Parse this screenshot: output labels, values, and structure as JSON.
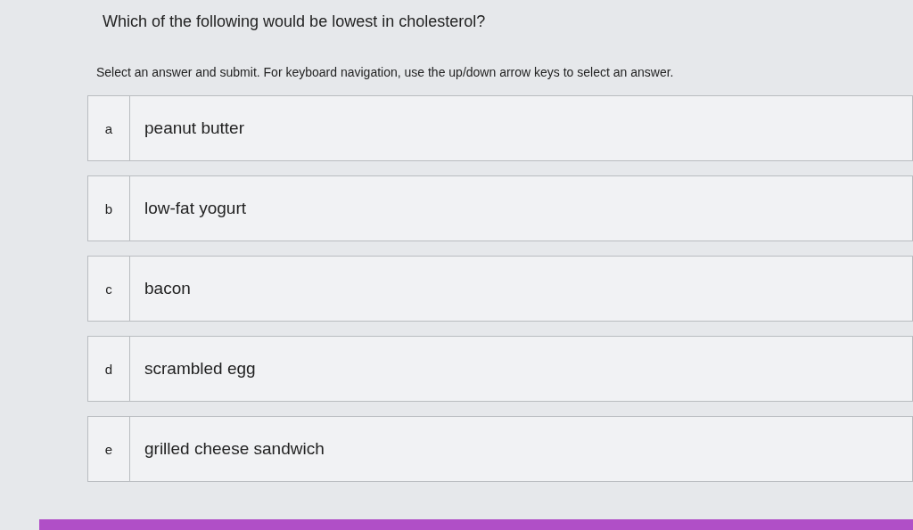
{
  "question": "Which of the following would be lowest in cholesterol?",
  "instructions": "Select an answer and submit. For keyboard navigation, use the up/down arrow keys to select an answer.",
  "answers": [
    {
      "letter": "a",
      "text": "peanut butter",
      "selected": false
    },
    {
      "letter": "b",
      "text": "low-fat yogurt",
      "selected": false
    },
    {
      "letter": "c",
      "text": "bacon",
      "selected": false
    },
    {
      "letter": "d",
      "text": "scrambled egg",
      "selected": false
    },
    {
      "letter": "e",
      "text": "grilled cheese sandwich",
      "selected": false
    }
  ]
}
